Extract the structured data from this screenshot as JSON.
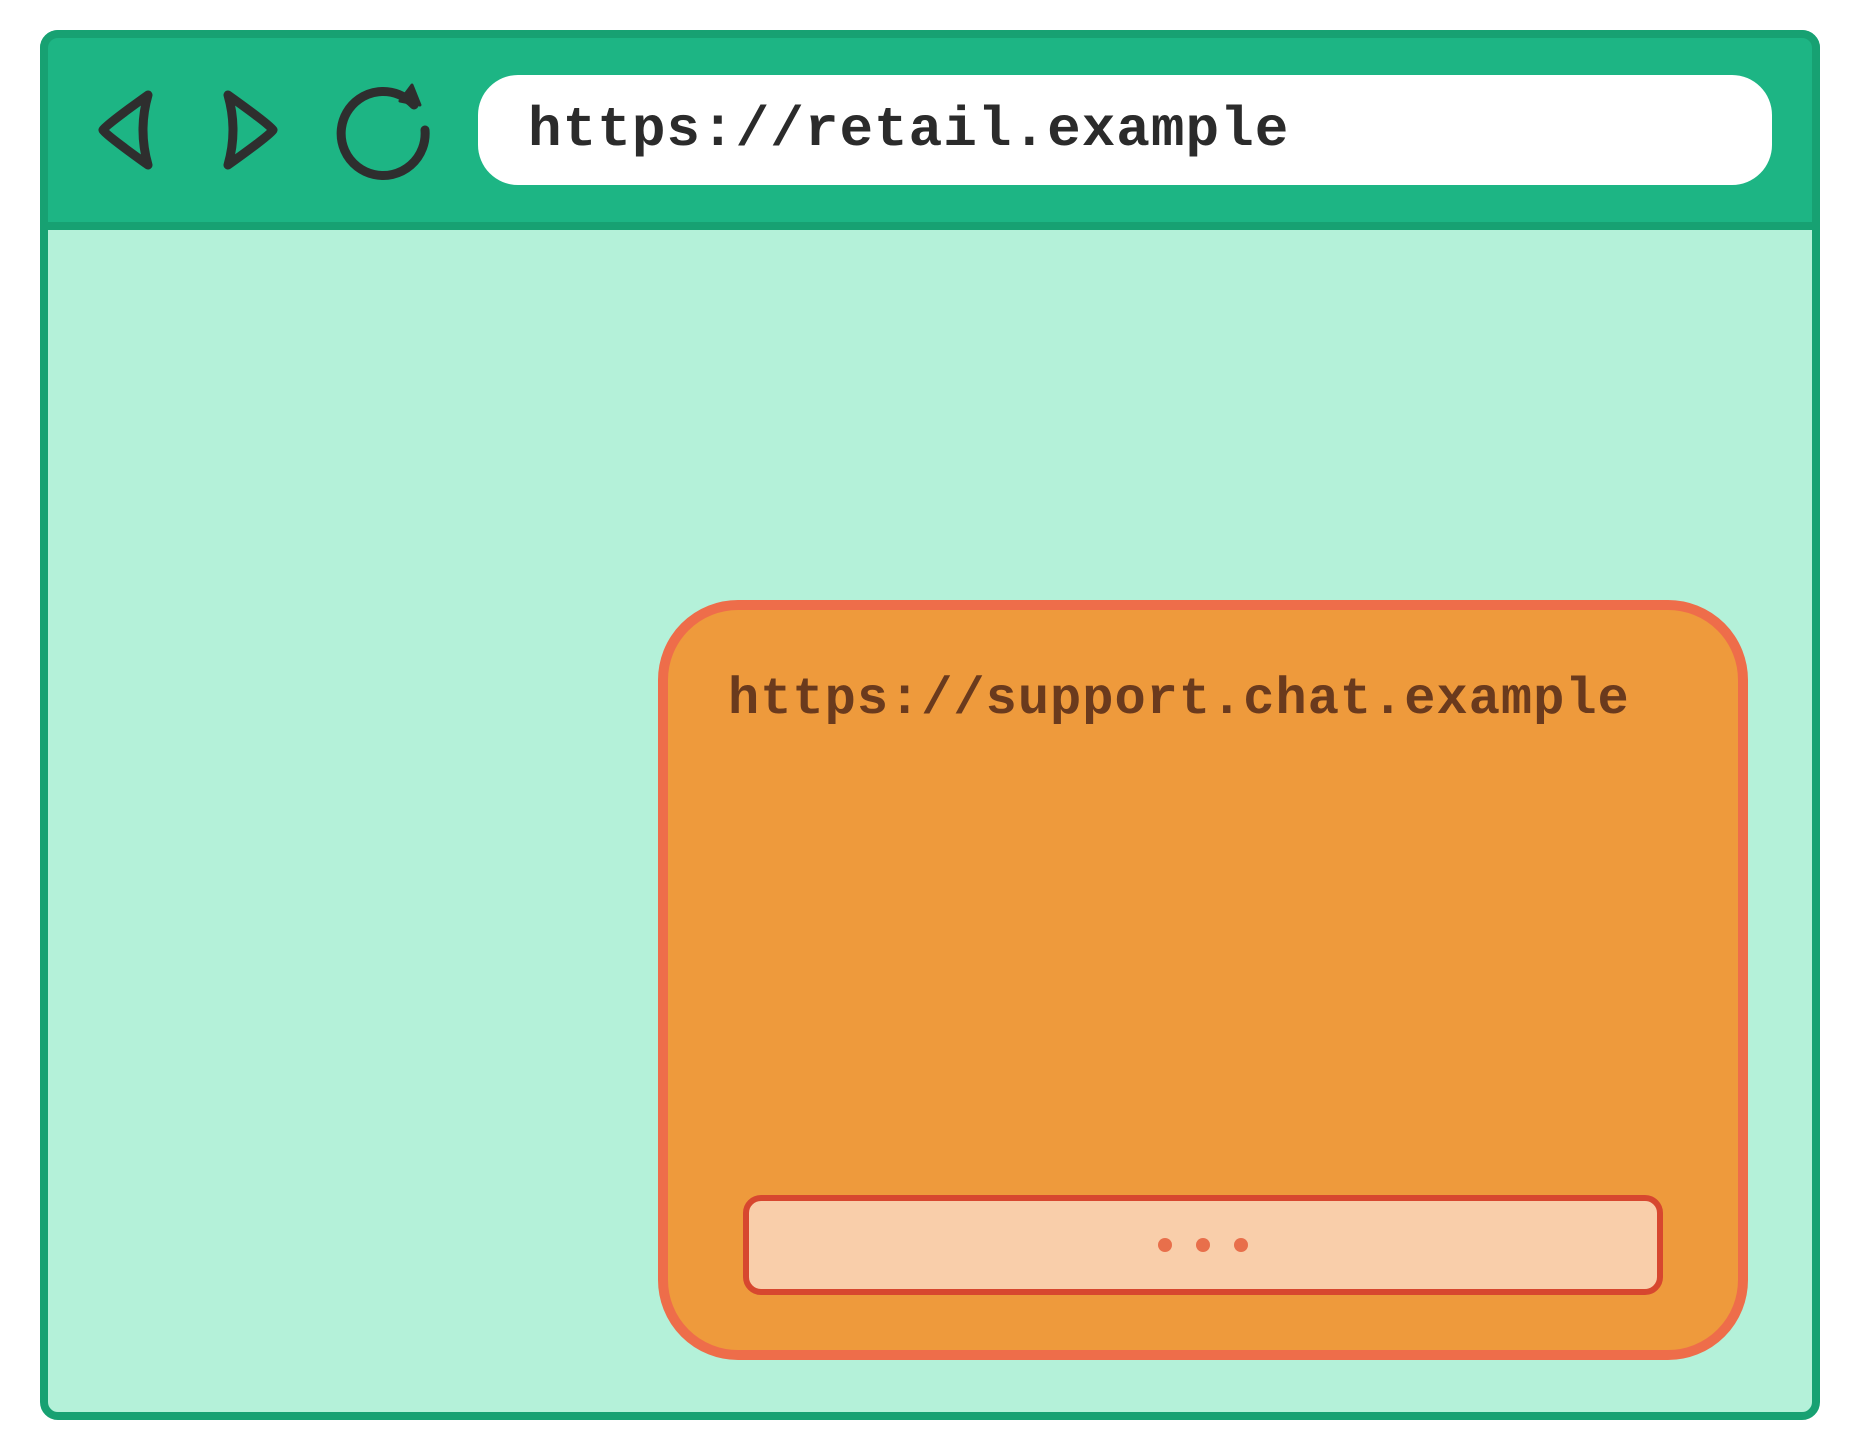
{
  "browser": {
    "url": "https://retail.example"
  },
  "chat_widget": {
    "url": "https://support.chat.example"
  }
}
